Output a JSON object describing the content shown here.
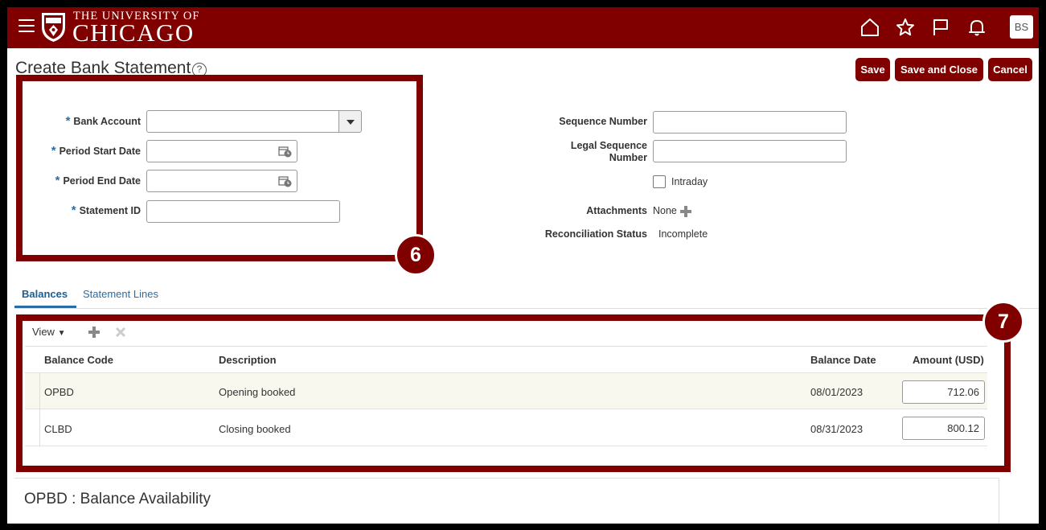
{
  "header": {
    "logo_line1": "THE UNIVERSITY OF",
    "logo_line2": "CHICAGO",
    "avatar": "BS",
    "icons": [
      "menu-icon",
      "home-icon",
      "star-icon",
      "flag-icon",
      "bell-icon"
    ]
  },
  "page": {
    "title": "Create Bank Statement",
    "help": "?"
  },
  "actions": {
    "save": "Save",
    "save_close": "Save and Close",
    "cancel": "Cancel"
  },
  "form": {
    "bank_account_label": "Bank Account",
    "period_start_label": "Period Start Date",
    "period_end_label": "Period End Date",
    "statement_id_label": "Statement ID",
    "required_mark": "*",
    "sequence_number_label": "Sequence Number",
    "legal_sequence_label_1": "Legal Sequence",
    "legal_sequence_label_2": "Number",
    "intraday_label": "Intraday",
    "attachments_label": "Attachments",
    "attachments_value": "None",
    "reconciliation_label": "Reconciliation Status",
    "reconciliation_value": "Incomplete"
  },
  "callouts": {
    "six": "6",
    "seven": "7"
  },
  "tabs": [
    {
      "label": "Balances",
      "active": true
    },
    {
      "label": "Statement Lines",
      "active": false
    }
  ],
  "table": {
    "view_label": "View",
    "columns": [
      "Balance Code",
      "Description",
      "Balance Date",
      "Amount (USD)"
    ],
    "rows": [
      {
        "code": "OPBD",
        "description": "Opening booked",
        "date": "08/01/2023",
        "amount": "712.06"
      },
      {
        "code": "CLBD",
        "description": "Closing booked",
        "date": "08/31/2023",
        "amount": "800.12"
      }
    ]
  },
  "detail": {
    "title": "OPBD : Balance Availability"
  },
  "colors": {
    "brand": "#800000",
    "link": "#2b6ca3",
    "selected_row": "#f8f8ee"
  }
}
